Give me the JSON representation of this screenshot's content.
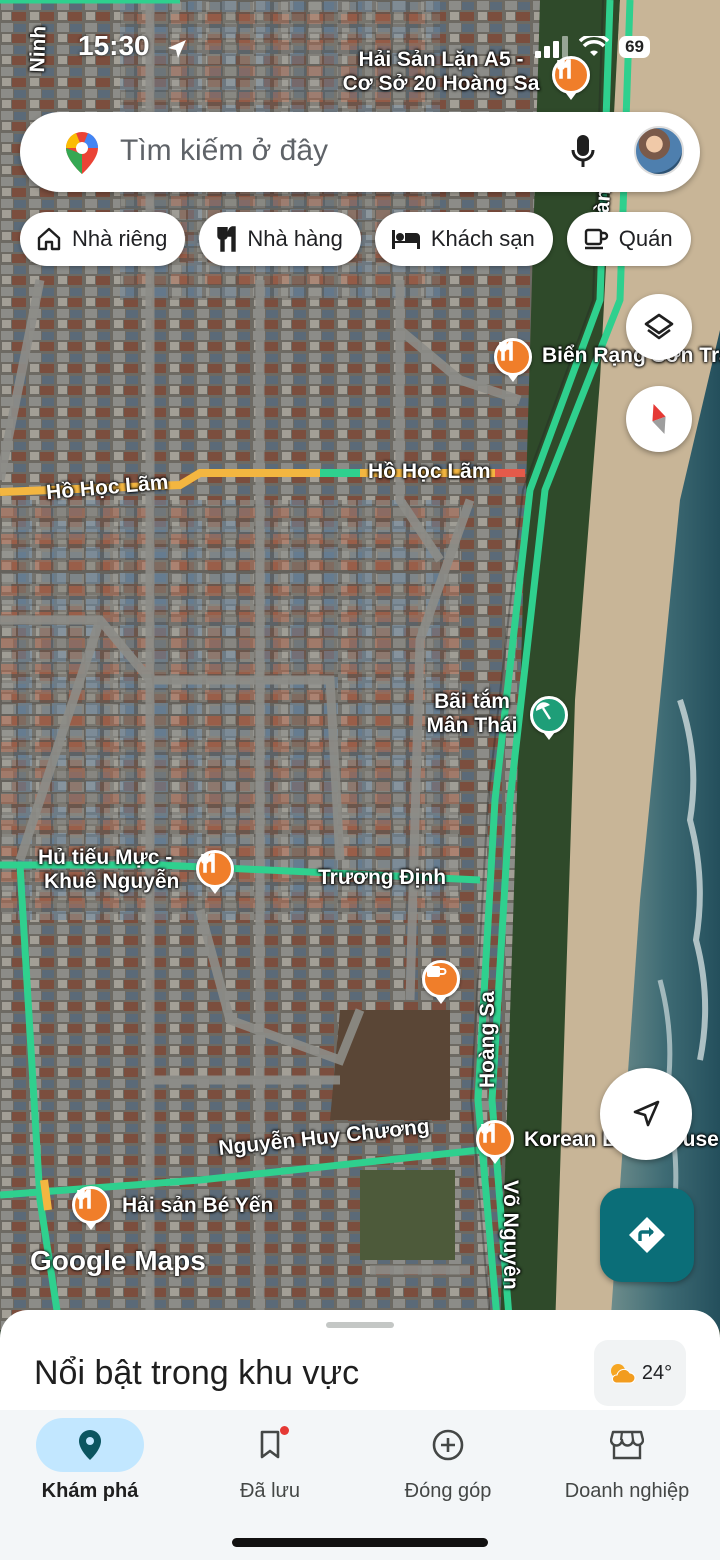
{
  "status_bar": {
    "time": "15:30",
    "battery": "69"
  },
  "search": {
    "placeholder": "Tìm kiếm ở đây"
  },
  "chips": [
    {
      "label": "Nhà riêng",
      "icon": "home-icon"
    },
    {
      "label": "Nhà hàng",
      "icon": "restaurant-icon"
    },
    {
      "label": "Khách sạn",
      "icon": "hotel-icon"
    },
    {
      "label": "Quán",
      "icon": "cafe-icon"
    }
  ],
  "map": {
    "streets": {
      "ninh": "Ninh",
      "ho_hoc_lam_1": "Hồ Học Lãm",
      "ho_hoc_lam_2": "Hồ Học Lãm",
      "truong_dinh": "Trương Định",
      "nguyen_huy_chuong": "Nguyễn Huy Chương",
      "hoang_sa_top": "Hoàng",
      "hoang_sa": "Hoàng Sa",
      "vo_nguyen": "Võ Nguyên"
    },
    "places": {
      "hai_san_lan_line1": "Hải Sản Lặn A5 -",
      "hai_san_lan_line2": "Cơ Sở 20 Hoàng Sa",
      "bien_rang": "Biển Rạng Sơn Trà",
      "bai_tam_line1": "Bãi tắm",
      "bai_tam_line2": "Mân Thái",
      "hu_tieu_line1": "Hủ tiếu Mực -",
      "hu_tieu_line2": "Khuê Nguyễn",
      "korean": "Korean BBQ House",
      "hai_san_be_yen": "Hải sản Bé Yến"
    },
    "attribution": "Google Maps",
    "colors": {
      "road_major": "#2fd08e",
      "road_yellow": "#f3b640",
      "pin_food": "#f07e2a",
      "pin_beach": "#1e9e78",
      "sea": "#2e5a66",
      "sand": "#c9b69a"
    }
  },
  "sheet": {
    "title": "Nổi bật trong khu vực",
    "weather_temp": "24°"
  },
  "nav": [
    {
      "label": "Khám phá",
      "icon": "explore-pin-icon",
      "active": true
    },
    {
      "label": "Đã lưu",
      "icon": "bookmark-icon",
      "active": false,
      "badge": true
    },
    {
      "label": "Đóng góp",
      "icon": "add-circle-icon",
      "active": false
    },
    {
      "label": "Doanh nghiệp",
      "icon": "storefront-icon",
      "active": false
    }
  ]
}
